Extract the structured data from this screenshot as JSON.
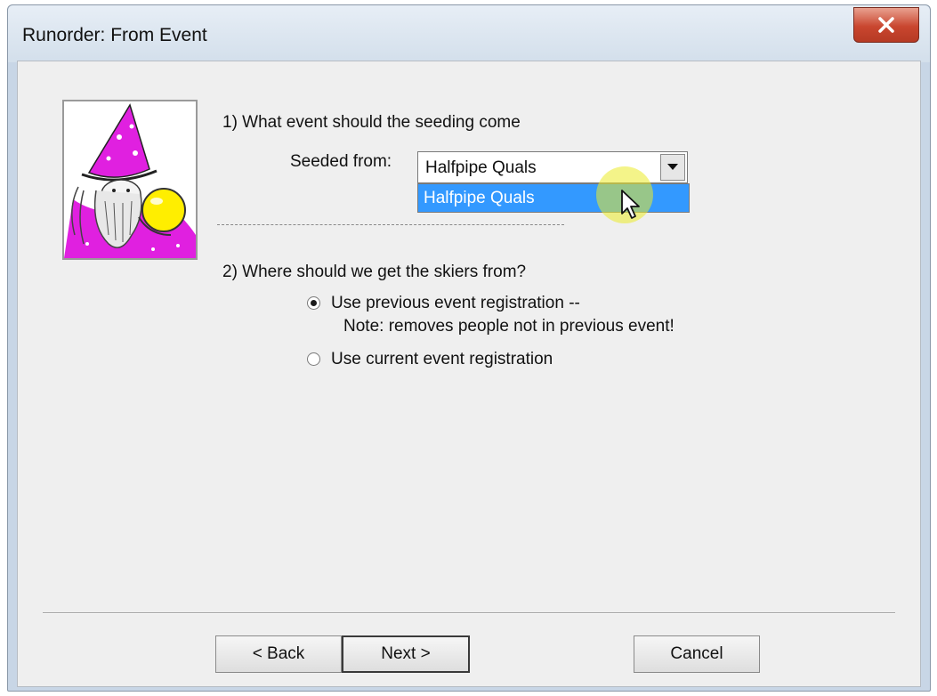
{
  "window": {
    "title": "Runorder: From Event",
    "close_glyph": "x"
  },
  "step1": {
    "question": "1) What event should the seeding come",
    "seeded_label": "Seeded from:",
    "combo_value": "Halfpipe Quals",
    "dropdown_options": [
      "Halfpipe Quals"
    ],
    "highlight_color": "#3399ff"
  },
  "step2": {
    "question": "2) Where should we get the skiers from?",
    "option1_label": "Use previous event registration  --",
    "option1_note": "Note:  removes people not in previous event!",
    "option1_selected": true,
    "option2_label": "Use current event registration",
    "option2_selected": false
  },
  "buttons": {
    "back": "< Back",
    "next": "Next >",
    "cancel": "Cancel"
  },
  "icons": {
    "wizard_image": "wizard-crystal-ball-icon",
    "combo_arrow": "chevron-down-icon",
    "cursor": "mouse-pointer-icon"
  },
  "colors": {
    "close_button": "#c9462f",
    "wizard_robe": "#e020e0",
    "crystal_ball": "#ffee00"
  }
}
